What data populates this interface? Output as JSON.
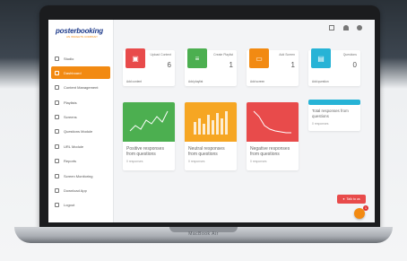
{
  "app": {
    "brand": "posterbooking",
    "brand_tagline": "AN INSIGHTS COMPANY"
  },
  "device": {
    "label": "MacBook Air"
  },
  "sidebar": {
    "items": [
      {
        "label": "Studio",
        "icon": "user-icon",
        "active": false
      },
      {
        "label": "Dashboard",
        "icon": "dashboard-icon",
        "active": true
      },
      {
        "label": "Content Management",
        "icon": "content-icon",
        "active": false
      },
      {
        "label": "Playlists",
        "icon": "playlist-icon",
        "active": false
      },
      {
        "label": "Screens",
        "icon": "screen-icon",
        "active": false
      },
      {
        "label": "Questions Module",
        "icon": "question-icon",
        "active": false
      },
      {
        "label": "URL Module",
        "icon": "link-icon",
        "active": false
      },
      {
        "label": "Reports",
        "icon": "report-icon",
        "active": false
      },
      {
        "label": "Screen Monitoring",
        "icon": "monitor-icon",
        "active": false
      },
      {
        "label": "Download App",
        "icon": "download-icon",
        "active": false
      },
      {
        "label": "Logout",
        "icon": "logout-icon",
        "active": false
      }
    ]
  },
  "topbar": {
    "icons": [
      "grid-icon",
      "bell-icon",
      "user-icon"
    ]
  },
  "stats": [
    {
      "label": "Upload Content",
      "value": "6",
      "link": "Add content",
      "color": "#e84b4b",
      "icon": "image-icon"
    },
    {
      "label": "Create Playlist",
      "value": "1",
      "link": "Add playlist",
      "color": "#4caf50",
      "icon": "playlist-add-icon"
    },
    {
      "label": "Add Screen",
      "value": "1",
      "link": "Add screen",
      "color": "#f28a12",
      "icon": "screen-add-icon"
    },
    {
      "label": "Questions",
      "value": "0",
      "link": "Add question",
      "color": "#27b3d6",
      "icon": "chat-icon"
    }
  ],
  "charts": [
    {
      "title": "Positive responses from questions",
      "sub": "0 responses",
      "color": "#4caf50"
    },
    {
      "title": "Neutral responses from questions",
      "sub": "0 responses",
      "color": "#f6a623"
    },
    {
      "title": "Negative responses from questions",
      "sub": "0 responses",
      "color": "#e84b4b"
    }
  ],
  "total": {
    "title": "Total responses from questions",
    "sub": "0 responses"
  },
  "talk": {
    "label": "Talk to us"
  },
  "chat": {
    "badge": "1"
  }
}
